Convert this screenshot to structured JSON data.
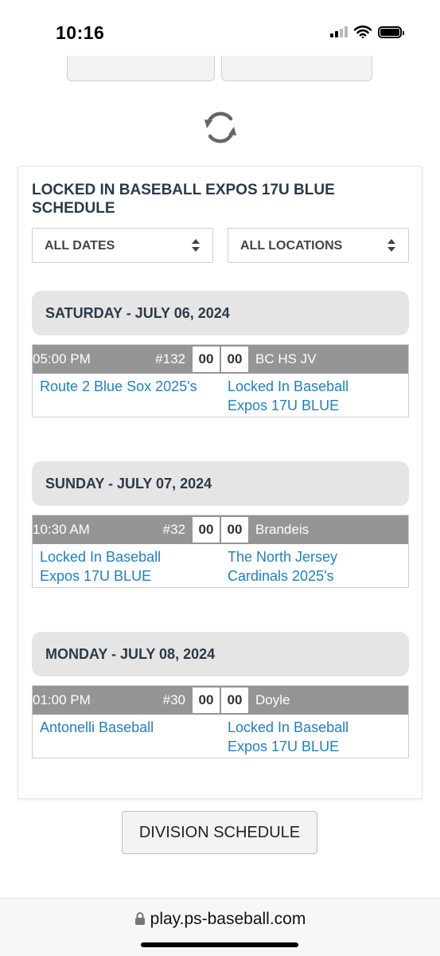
{
  "status_bar": {
    "time": "10:16"
  },
  "schedule": {
    "title": "LOCKED IN BASEBALL EXPOS 17U BLUE SCHEDULE",
    "filters": {
      "dates": "ALL DATES",
      "locations": "ALL LOCATIONS"
    },
    "days": [
      {
        "label": "SATURDAY - JULY 06, 2024",
        "games": [
          {
            "time": "05:00 PM",
            "number": "#132",
            "home_score": "00",
            "away_score": "00",
            "location": "BC HS JV",
            "home_team": "Route 2 Blue Sox 2025's",
            "away_team": "Locked In Baseball Expos 17U BLUE"
          }
        ]
      },
      {
        "label": "SUNDAY - JULY 07, 2024",
        "games": [
          {
            "time": "10:30 AM",
            "number": "#32",
            "home_score": "00",
            "away_score": "00",
            "location": "Brandeis",
            "home_team": "Locked In Baseball Expos 17U BLUE",
            "away_team": "The North Jersey Cardinals 2025's"
          }
        ]
      },
      {
        "label": "MONDAY - JULY 08, 2024",
        "games": [
          {
            "time": "01:00 PM",
            "number": "#30",
            "home_score": "00",
            "away_score": "00",
            "location": "Doyle",
            "home_team": "Antonelli Baseball",
            "away_team": "Locked In Baseball Expos 17U BLUE"
          }
        ]
      }
    ]
  },
  "division_button_label": "DIVISION SCHEDULE",
  "browser": {
    "url": "play.ps-baseball.com"
  },
  "icons": {
    "refresh": "refresh-icon",
    "lock": "lock-icon",
    "select_arrows": "sort-arrows-icon"
  },
  "colors": {
    "game_bar": "#959595",
    "team_link": "#1e80c6",
    "day_header_bg": "#e5e5e5",
    "title_text": "#2c3a48"
  }
}
